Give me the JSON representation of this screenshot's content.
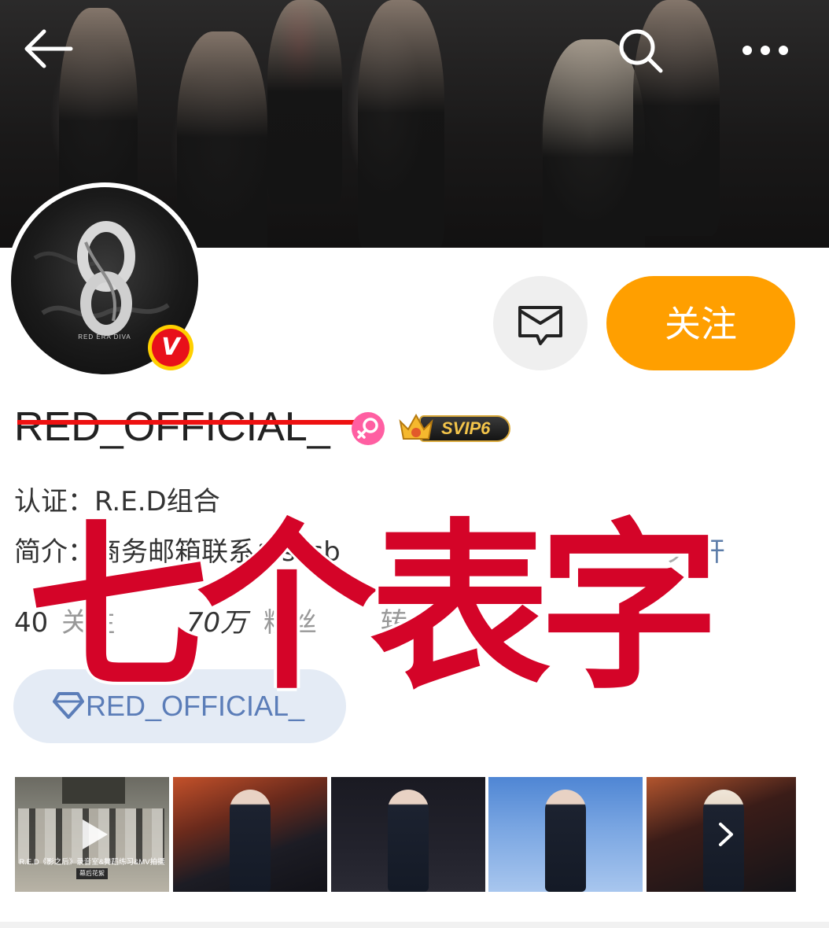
{
  "header": {
    "back_icon": "arrow-left-icon",
    "search_icon": "search-icon",
    "more_icon": "more-horizontal-icon"
  },
  "profile": {
    "avatar_caption": "RED ERA DIVA",
    "verified_badge": "V",
    "message_icon": "mail-icon",
    "follow_label": "关注",
    "username": "RED_OFFICIAL_",
    "gender_icon": "female-icon",
    "vip_label": "SVIP6",
    "verification": "认证：R.E.D组合",
    "bio": "简介：商务邮箱联系：sssb",
    "bio_tail": "ッ",
    "expand_label": "开",
    "stats_following": "40",
    "stats_following_label": "关注",
    "stats_followers": "70万",
    "stats_followers_label": "粉丝",
    "stats_extra_label": "转",
    "fan_group_label": "RED_OFFICIAL_"
  },
  "overlay_text": [
    "七",
    "个",
    "表",
    "字"
  ],
  "media": {
    "thumb1_caption": "R.E.D《影之后》录音室&舞蹈练习&MV拍摄",
    "thumb1_sub": "幕后花絮",
    "next_icon": "chevron-right-icon",
    "play_icon": "play-icon"
  },
  "colors": {
    "accent_orange": "#ff9f00",
    "overlay_red": "#d40428",
    "link_blue": "#5c7ca8"
  }
}
